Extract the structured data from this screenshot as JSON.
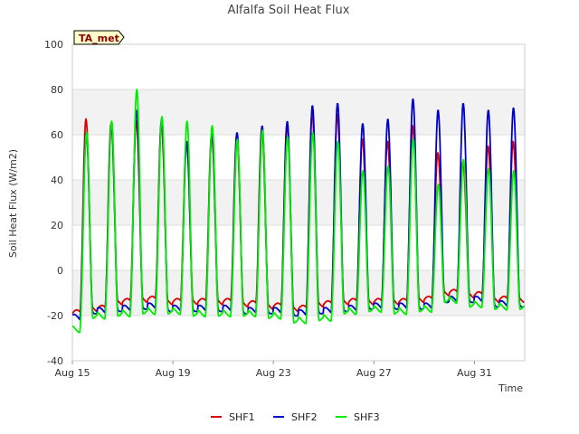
{
  "chart_data": {
    "type": "line",
    "title": "Alfalfa Soil Heat Flux",
    "xlabel": "Time",
    "ylabel": "Soil Heat Flux (W/m2)",
    "badge": "TA_met",
    "ylim": [
      -40,
      100
    ],
    "yticks": [
      -40,
      -20,
      0,
      20,
      40,
      60,
      80,
      100
    ],
    "xlim": [
      "2024-08-15",
      "2024-09-02"
    ],
    "xticks": [
      {
        "date": "2024-08-15",
        "label": "Aug 15"
      },
      {
        "date": "2024-08-19",
        "label": "Aug 19"
      },
      {
        "date": "2024-08-23",
        "label": "Aug 23"
      },
      {
        "date": "2024-08-27",
        "label": "Aug 27"
      },
      {
        "date": "2024-08-31",
        "label": "Aug 31"
      }
    ],
    "background_bands": true,
    "legend_position": "bottom-center",
    "days": [
      "2024-08-15",
      "2024-08-16",
      "2024-08-17",
      "2024-08-18",
      "2024-08-19",
      "2024-08-20",
      "2024-08-21",
      "2024-08-22",
      "2024-08-23",
      "2024-08-24",
      "2024-08-25",
      "2024-08-26",
      "2024-08-27",
      "2024-08-28",
      "2024-08-29",
      "2024-08-30",
      "2024-08-31",
      "2024-09-01"
    ],
    "series": [
      {
        "name": "SHF1",
        "color": "#dd0000",
        "daily_max": [
          67,
          65,
          66,
          65,
          57,
          60,
          60,
          63,
          65,
          70,
          69,
          58,
          57,
          64,
          52,
          48,
          55,
          57
        ],
        "daily_min": [
          -19,
          -17,
          -14,
          -13,
          -14,
          -14,
          -14,
          -15,
          -16,
          -17,
          -15,
          -14,
          -14,
          -14,
          -13,
          -10,
          -11,
          -13
        ]
      },
      {
        "name": "SHF2",
        "color": "#0000cc",
        "daily_max": [
          61,
          65,
          71,
          67,
          57,
          61,
          61,
          64,
          66,
          73,
          74,
          65,
          67,
          76,
          71,
          74,
          71,
          72
        ],
        "daily_min": [
          -21,
          -18,
          -17,
          -16,
          -17,
          -17,
          -17,
          -18,
          -18,
          -19,
          -18,
          -17,
          -16,
          -16,
          -16,
          -13,
          -13,
          -15
        ]
      },
      {
        "name": "SHF3",
        "color": "#00ee00",
        "daily_max": [
          61,
          66,
          80,
          68,
          66,
          64,
          58,
          62,
          59,
          61,
          57,
          44,
          46,
          58,
          38,
          49,
          45,
          44
        ],
        "daily_min": [
          -26,
          -20,
          -19,
          -18,
          -18,
          -19,
          -19,
          -19,
          -20,
          -22,
          -21,
          -18,
          -17,
          -18,
          -17,
          -13,
          -15,
          -16
        ]
      }
    ]
  }
}
